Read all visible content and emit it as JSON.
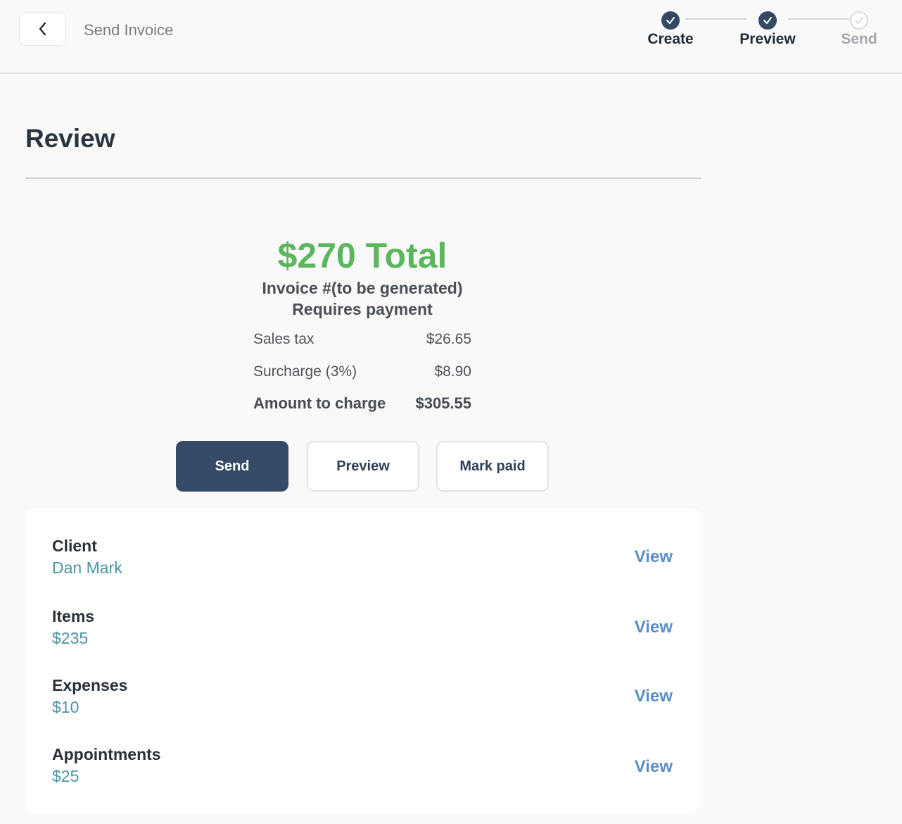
{
  "header": {
    "title": "Send Invoice",
    "steps": [
      {
        "label": "Create",
        "status": "done"
      },
      {
        "label": "Preview",
        "status": "done"
      },
      {
        "label": "Send",
        "status": "todo"
      }
    ]
  },
  "page_title": "Review",
  "summary": {
    "total": "$270 Total",
    "invoice_number": "Invoice #(to be generated)",
    "status": "Requires payment",
    "rows": [
      {
        "label": "Sales tax",
        "value": "$26.65"
      },
      {
        "label": "Surcharge (3%)",
        "value": "$8.90"
      },
      {
        "label": "Amount to charge",
        "value": "$305.55"
      }
    ]
  },
  "actions": {
    "send": "Send",
    "preview": "Preview",
    "mark_paid": "Mark paid"
  },
  "details": [
    {
      "label": "Client",
      "value": "Dan Mark",
      "action": "View"
    },
    {
      "label": "Items",
      "value": "$235",
      "action": "View"
    },
    {
      "label": "Expenses",
      "value": "$10",
      "action": "View"
    },
    {
      "label": "Appointments",
      "value": "$25",
      "action": "View"
    }
  ],
  "colors": {
    "total_green": "#5bb75e",
    "primary_navy": "#344a67",
    "link_blue": "#5b8dc7",
    "value_teal": "#4a94a2"
  }
}
